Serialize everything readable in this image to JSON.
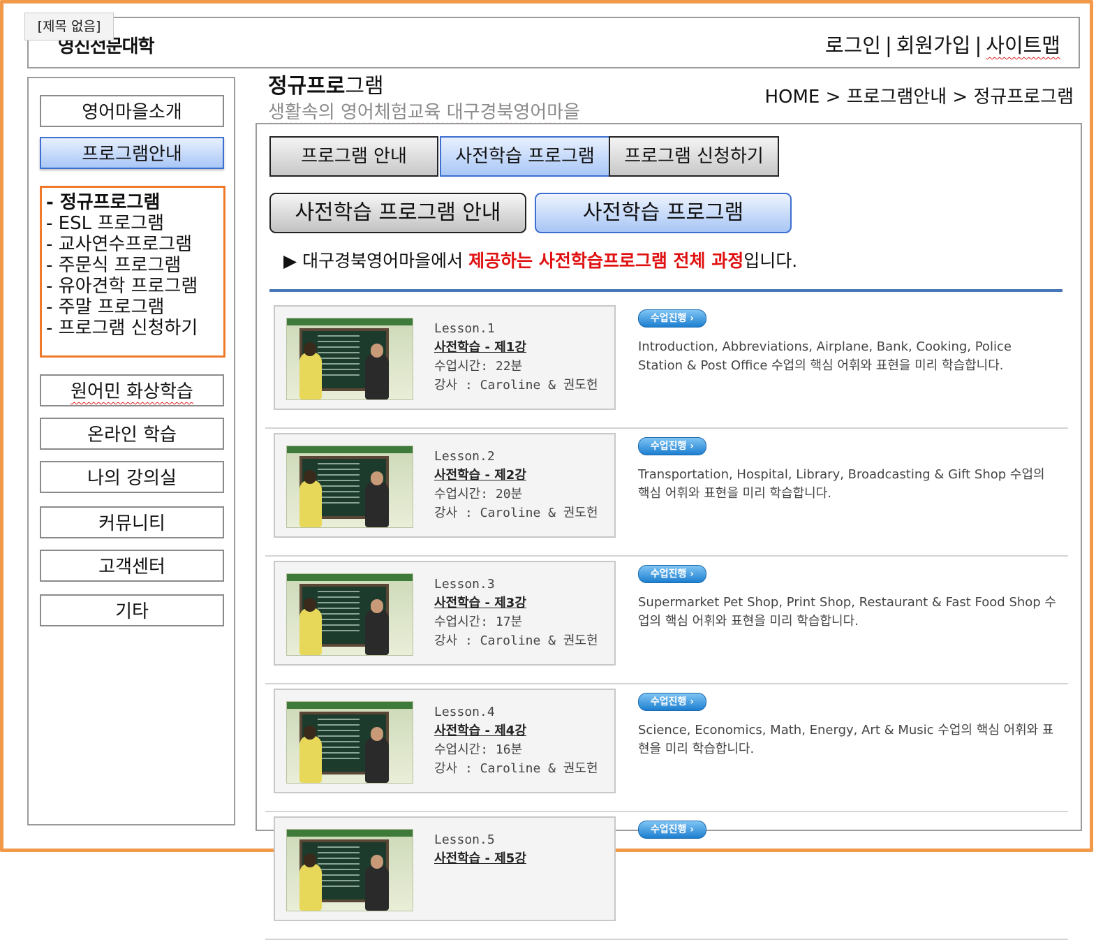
{
  "window": {
    "tab_title": "[제목 없음]"
  },
  "header": {
    "logo": "영진전문대학",
    "links": [
      "로그인",
      "회원가입",
      "사이트맵"
    ],
    "separator": "|"
  },
  "sidebar": {
    "items": [
      "영어마을소개",
      "프로그램안내",
      "원어민 화상학습",
      "온라인 학습",
      "나의 강의실",
      "커뮤니티",
      "고객센터",
      "기타"
    ],
    "active": "프로그램안내",
    "submenu": [
      "- 정규프로그램",
      "- ESL 프로그램",
      "- 교사연수프로그램",
      "- 주문식 프로그램",
      "- 유아견학 프로그램",
      "- 주말 프로그램",
      "- 프로그램 신청하기"
    ]
  },
  "page": {
    "title_bold": "정규프로",
    "title_rest": "그램",
    "subtitle": "생활속의 영어체험교육 대구경북영어마을",
    "breadcrumb": "HOME > 프로그램안내 > 정규프로그램"
  },
  "tabs": [
    "프로그램 안내",
    "사전학습 프로그램",
    "프로그램 신청하기"
  ],
  "subtabs": [
    "사전학습 프로그램 안내",
    "사전학습 프로그램"
  ],
  "notice": {
    "prefix": "▶ 대구경북영어마을에서 ",
    "highlight": "제공하는 사전학습프로그램 전체 과정",
    "suffix": "입니다."
  },
  "button_label": "수업진행 ›",
  "lessons": [
    {
      "no": "Lesson.1",
      "title": "사전학습 - 제1강",
      "time": "수업시간: 22분",
      "teacher": "강사 : Caroline & 권도헌",
      "desc": "Introduction, Abbreviations, Airplane, Bank, Cooking, Police Station & Post Office 수업의 핵심 어휘와 표현을 미리 학습합니다."
    },
    {
      "no": "Lesson.2",
      "title": "사전학습 - 제2강",
      "time": "수업시간: 20분",
      "teacher": "강사 : Caroline & 권도헌",
      "desc": "Transportation, Hospital, Library, Broadcasting & Gift Shop 수업의 핵심 어휘와 표현을 미리 학습합니다."
    },
    {
      "no": "Lesson.3",
      "title": "사전학습 - 제3강",
      "time": "수업시간: 17분",
      "teacher": "강사 : Caroline & 권도헌",
      "desc": "Supermarket Pet Shop, Print Shop, Restaurant & Fast Food Shop 수업의 핵심 어휘와 표현을 미리 학습합니다."
    },
    {
      "no": "Lesson.4",
      "title": "사전학습 - 제4강",
      "time": "수업시간: 16분",
      "teacher": "강사 : Caroline & 권도헌",
      "desc": "Science, Economics, Math, Energy, Art & Music 수업의 핵심 어휘와 표현을 미리 학습합니다."
    },
    {
      "no": "Lesson.5",
      "title": "사전학습 - 제5강",
      "time": "",
      "teacher": "",
      "desc": ""
    }
  ]
}
